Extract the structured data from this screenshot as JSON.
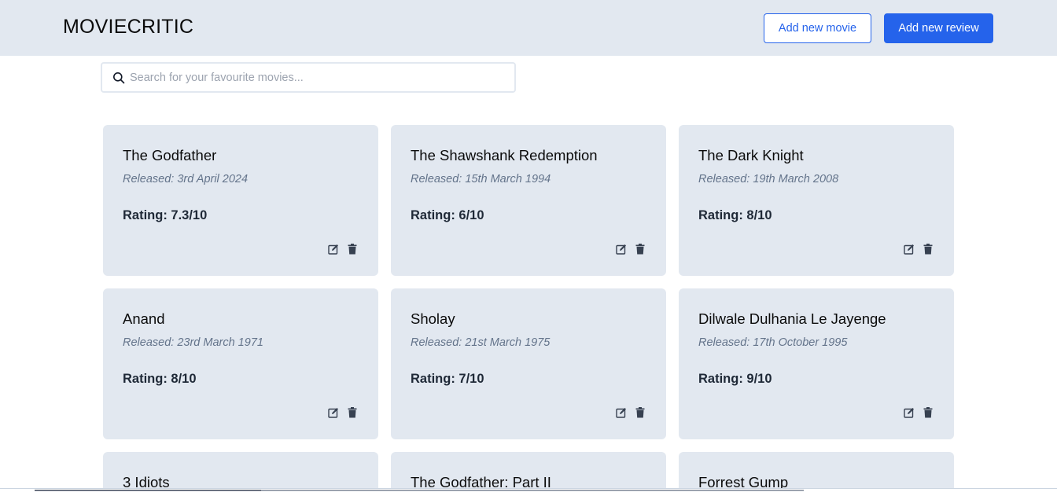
{
  "header": {
    "logo": "MOVIECRITIC",
    "add_movie_label": "Add new movie",
    "add_review_label": "Add new review"
  },
  "search": {
    "placeholder": "Search for your favourite movies...",
    "value": ""
  },
  "colors": {
    "header_bg": "#e2e8f0",
    "card_bg": "#e2e8f0",
    "accent": "#2563eb"
  },
  "icons": {
    "search": "search-icon",
    "edit": "edit-icon",
    "delete": "trash-icon"
  },
  "movies": [
    {
      "title": "The Godfather",
      "released": "Released: 3rd April 2024",
      "rating": "Rating: 7.3/10"
    },
    {
      "title": "The Shawshank Redemption",
      "released": "Released: 15th March 1994",
      "rating": "Rating: 6/10"
    },
    {
      "title": "The Dark Knight",
      "released": "Released: 19th March 2008",
      "rating": "Rating: 8/10"
    },
    {
      "title": "Anand",
      "released": "Released: 23rd March 1971",
      "rating": "Rating: 8/10"
    },
    {
      "title": "Sholay",
      "released": "Released: 21st March 1975",
      "rating": "Rating: 7/10"
    },
    {
      "title": "Dilwale Dulhania Le Jayenge",
      "released": "Released: 17th October 1995",
      "rating": "Rating: 9/10"
    },
    {
      "title": "3 Idiots",
      "released": "",
      "rating": ""
    },
    {
      "title": "The Godfather: Part II",
      "released": "",
      "rating": ""
    },
    {
      "title": "Forrest Gump",
      "released": "",
      "rating": ""
    }
  ]
}
